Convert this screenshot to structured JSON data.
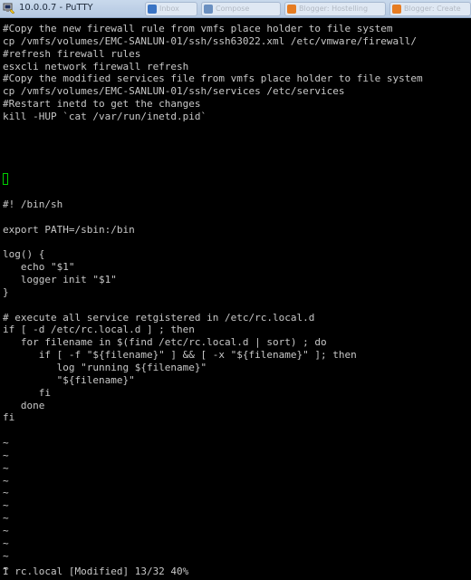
{
  "window": {
    "title": "10.0.0.7 - PuTTY",
    "app_icon": "putty-icon"
  },
  "taskbar": {
    "tabs": [
      {
        "label": "Inbox",
        "icon": "mail-icon",
        "color": "#3a74c4"
      },
      {
        "label": "Compose",
        "icon": "doc-icon",
        "color": "#6a8fc0"
      },
      {
        "label": "Blogger: Hostelling",
        "icon": "blogger-icon",
        "color": "#e67c22"
      },
      {
        "label": "Blogger: Create",
        "icon": "blogger-icon",
        "color": "#e67c22"
      }
    ]
  },
  "terminal": {
    "colors": {
      "background": "#000000",
      "text": "#c8c8c8",
      "cursor": "#00d000"
    },
    "lines": [
      "#Copy the new firewall rule from vmfs place holder to file system",
      "cp /vmfs/volumes/EMC-SANLUN-01/ssh/ssh63022.xml /etc/vmware/firewall/",
      "#refresh firewall rules",
      "esxcli network firewall refresh",
      "#Copy the modified services file from vmfs place holder to file system",
      "cp /vmfs/volumes/EMC-SANLUN-01/ssh/services /etc/services",
      "#Restart inetd to get the changes",
      "kill -HUP `cat /var/run/inetd.pid`",
      "",
      "",
      "",
      "",
      "",
      "",
      "#! /bin/sh",
      "",
      "export PATH=/sbin:/bin",
      "",
      "log() {",
      "   echo \"$1\"",
      "   logger init \"$1\"",
      "}",
      "",
      "# execute all service retgistered in /etc/rc.local.d",
      "if [ -d /etc/rc.local.d ] ; then",
      "   for filename in $(find /etc/rc.local.d | sort) ; do",
      "      if [ -f \"${filename}\" ] && [ -x \"${filename}\" ]; then",
      "         log \"running ${filename}\"",
      "         \"${filename}\"",
      "      fi",
      "   done",
      "fi",
      "",
      "~",
      "~",
      "~",
      "~",
      "~",
      "~",
      "~",
      "~",
      "~",
      "~",
      "~",
      "~",
      "I rc.local [Modified] 13/32 40%"
    ]
  }
}
